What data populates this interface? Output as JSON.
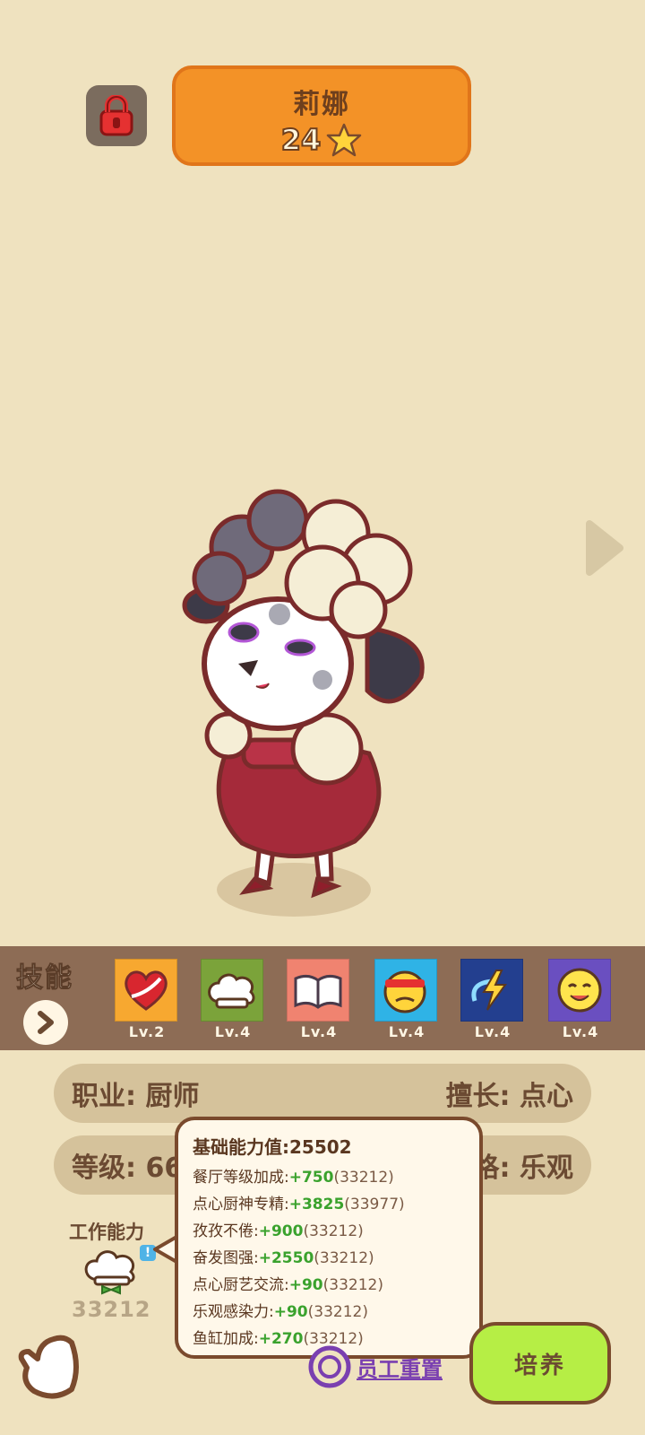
{
  "header": {
    "name": "莉娜",
    "stars": "24",
    "lock_icon": "lock-icon",
    "star_icon": "star-icon"
  },
  "skills": {
    "title": "技能",
    "items": [
      {
        "icon": "heart-arrow-icon",
        "level": "Lv.2",
        "bg": "#f7a830"
      },
      {
        "icon": "chef-hat-icon",
        "level": "Lv.4",
        "bg": "#7ba33a"
      },
      {
        "icon": "book-icon",
        "level": "Lv.4",
        "bg": "#f08370"
      },
      {
        "icon": "headband-face-icon",
        "level": "Lv.4",
        "bg": "#2fb3e6"
      },
      {
        "icon": "lightning-swirl-icon",
        "level": "Lv.4",
        "bg": "#233f8f"
      },
      {
        "icon": "smile-face-icon",
        "level": "Lv.4",
        "bg": "#6a4fc0"
      }
    ]
  },
  "info": {
    "profession": "职业: 厨师",
    "specialty": "擅长: 点心",
    "level_partial": "等级: 66",
    "personality_partial": "格: 乐观"
  },
  "work": {
    "label": "工作能力",
    "value": "33212"
  },
  "tooltip": {
    "title": "基础能力值:25502",
    "rows": [
      {
        "label": "餐厅等级加成:",
        "add": "+750",
        "paren": "(33212)"
      },
      {
        "label": "点心厨神专精:",
        "add": "+3825",
        "paren": "(33977)"
      },
      {
        "label": "孜孜不倦:",
        "add": "+900",
        "paren": "(33212)"
      },
      {
        "label": "奋发图强:",
        "add": "+2550",
        "paren": "(33212)"
      },
      {
        "label": "点心厨艺交流:",
        "add": "+90",
        "paren": "(33212)"
      },
      {
        "label": "乐观感染力:",
        "add": "+90",
        "paren": "(33212)"
      },
      {
        "label": "鱼缸加成:",
        "add": "+270",
        "paren": "(33212)"
      }
    ]
  },
  "footer": {
    "reset_label": "员工重置",
    "cultivate_label": "培养"
  },
  "colors": {
    "background": "#efe2bf",
    "name_panel": "#f39227",
    "skills_bar": "#8d6c55",
    "cultivate_button": "#b6ee45",
    "bonus_green": "#3aa22d"
  }
}
